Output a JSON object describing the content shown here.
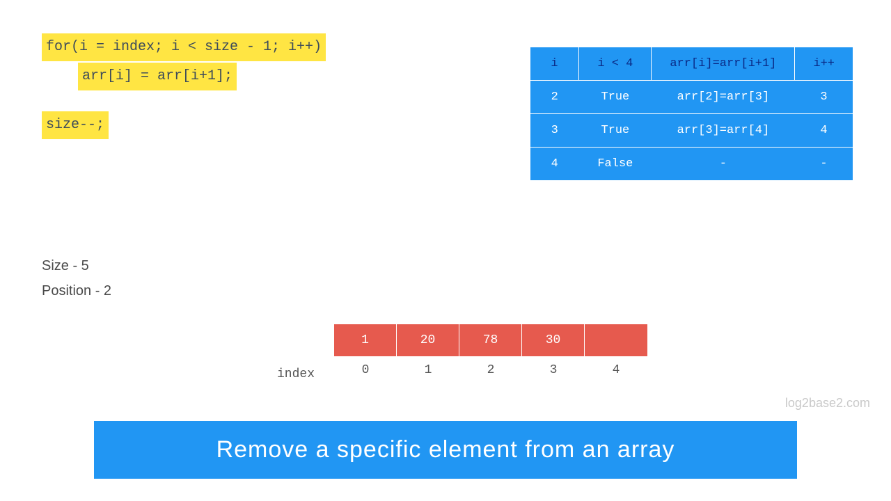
{
  "code": {
    "line1": "for(i = index; i < size - 1; i++)",
    "line2": "arr[i] = arr[i+1];",
    "line3": "size--;"
  },
  "trace": {
    "headers": [
      "i",
      "i < 4",
      "arr[i]=arr[i+1]",
      "i++"
    ],
    "rows": [
      [
        "2",
        "True",
        "arr[2]=arr[3]",
        "3"
      ],
      [
        "3",
        "True",
        "arr[3]=arr[4]",
        "4"
      ],
      [
        "4",
        "False",
        "-",
        "-"
      ]
    ]
  },
  "info": {
    "size": "Size - 5",
    "position": "Position - 2"
  },
  "array": {
    "label": "index",
    "values": [
      "1",
      "20",
      "78",
      "30",
      ""
    ],
    "indices": [
      "0",
      "1",
      "2",
      "3",
      "4"
    ]
  },
  "watermark": "log2base2.com",
  "title": "Remove a specific element from an array",
  "chart_data": {
    "type": "table",
    "description": "Execution trace of for-loop removing element at index 2 from array of size 5",
    "headers": [
      "i",
      "i < 4",
      "arr[i]=arr[i+1]",
      "i++"
    ],
    "rows": [
      {
        "i": 2,
        "condition": "True",
        "assignment": "arr[2]=arr[3]",
        "increment": 3
      },
      {
        "i": 3,
        "condition": "True",
        "assignment": "arr[3]=arr[4]",
        "increment": 4
      },
      {
        "i": 4,
        "condition": "False",
        "assignment": "-",
        "increment": "-"
      }
    ],
    "array_state": {
      "values": [
        1,
        20,
        78,
        30,
        null
      ],
      "indices": [
        0,
        1,
        2,
        3,
        4
      ]
    },
    "size": 5,
    "position": 2
  }
}
